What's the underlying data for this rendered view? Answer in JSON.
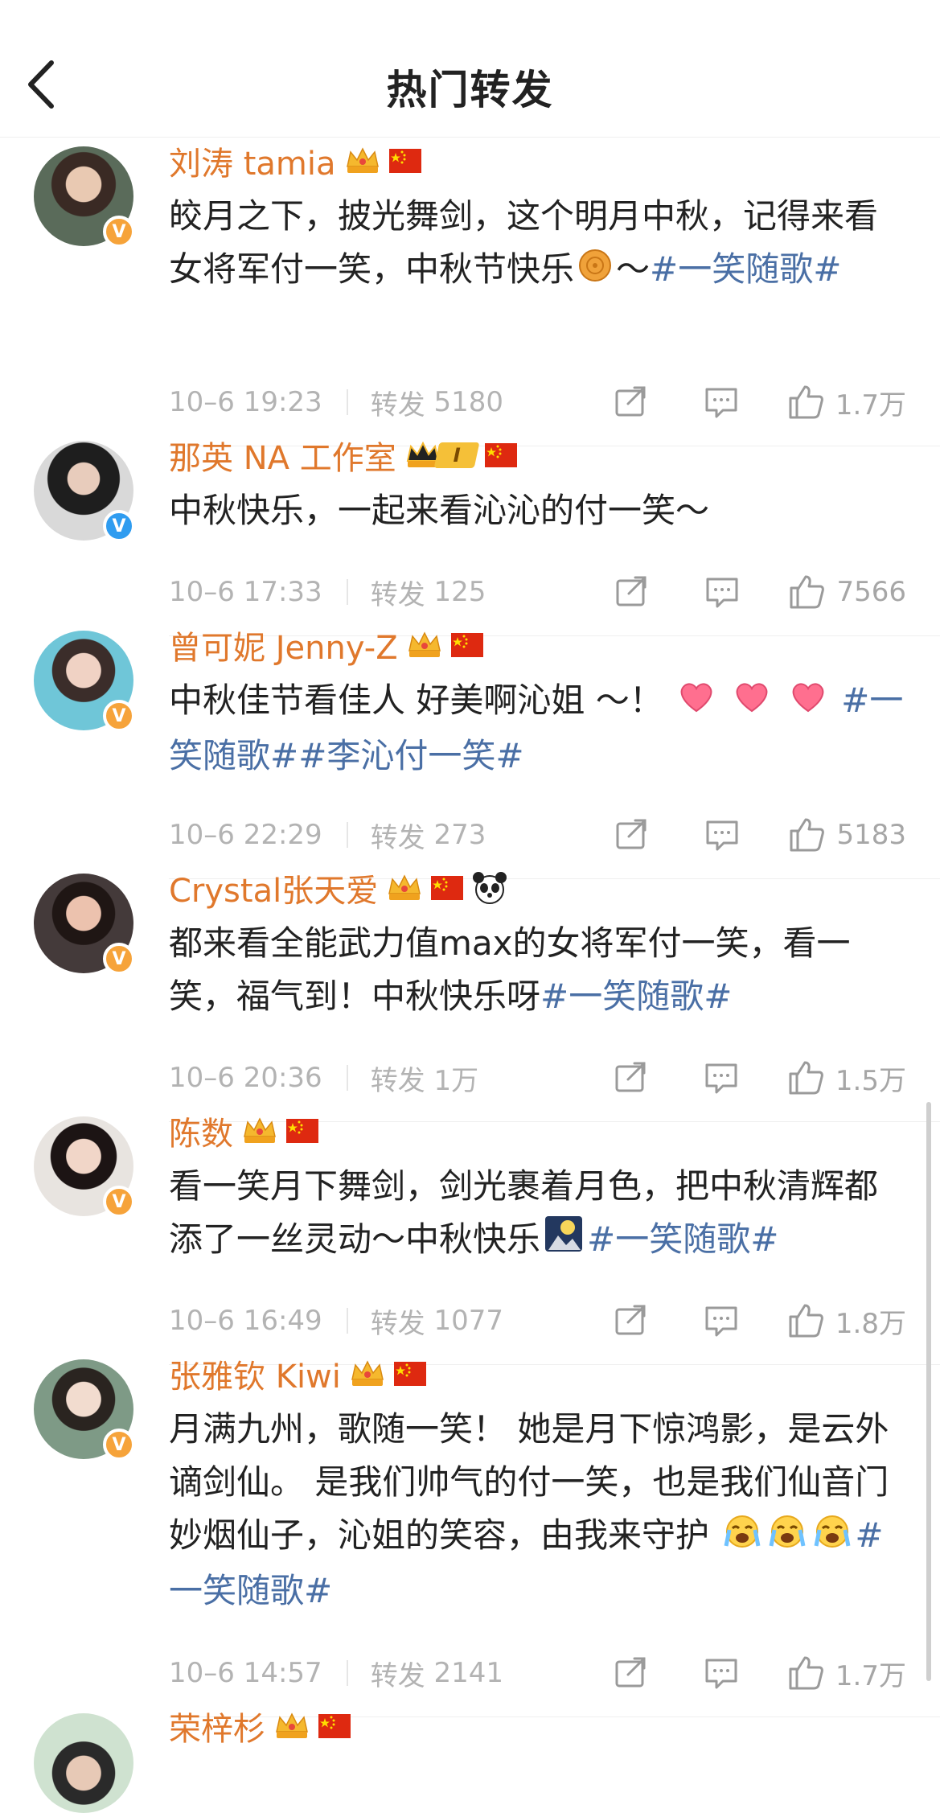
{
  "header": {
    "title": "热门转发"
  },
  "colors": {
    "name": "#e0782c",
    "tag": "#4a6fa5",
    "meta": "#b3b3b3",
    "v_orange": "#f6a33a",
    "v_blue": "#2f9cf0"
  },
  "posts": [
    {
      "name": "刘涛 tamia",
      "badges": [
        "gold-crown-badge",
        "china-flag-icon"
      ],
      "verified": "orange",
      "text_parts": [
        "皎月之下，披光舞剑，这个明月中秋，记得来看女将军付一笑，中秋节快乐",
        "～",
        "#一笑随歌#"
      ],
      "emoji": "mooncake-emoji",
      "time": "10–6 19:23",
      "repost_label": "转发",
      "repost_count": "5180",
      "likes": "1.7万"
    },
    {
      "name": "那英 NA 工作室",
      "badges": [
        "crown-level-badge",
        "china-flag-icon"
      ],
      "level": "I",
      "verified": "blue",
      "text_parts": [
        "中秋快乐，一起来看沁沁的付一笑～"
      ],
      "time": "10–6 17:33",
      "repost_label": "转发",
      "repost_count": "125",
      "likes": "7566"
    },
    {
      "name": "曾可妮 Jenny-Z",
      "badges": [
        "gold-crown-badge",
        "china-flag-icon"
      ],
      "verified": "orange",
      "text_parts": [
        "中秋佳节看佳人 好美啊沁姐 ～！",
        "#一笑随歌##李沁付一笑#"
      ],
      "emoji": "heart-emoji",
      "time": "10–6 22:29",
      "repost_label": "转发",
      "repost_count": "273",
      "likes": "5183"
    },
    {
      "name": "Crystal张天爱",
      "badges": [
        "gold-crown-badge",
        "china-flag-icon",
        "panda-icon"
      ],
      "verified": "orange",
      "text_parts": [
        "都来看全能武力值max的女将军付一笑，看一笑，福气到！中秋快乐呀",
        "#一笑随歌#"
      ],
      "time": "10–6 20:36",
      "repost_label": "转发",
      "repost_count": "1万",
      "likes": "1.5万"
    },
    {
      "name": "陈数",
      "badges": [
        "gold-crown-badge",
        "china-flag-icon"
      ],
      "verified": "orange",
      "text_parts": [
        "看一笑月下舞剑，剑光裹着月色，把中秋清辉都添了一丝灵动～中秋快乐",
        "#一笑随歌#"
      ],
      "emoji": "moon-night-emoji",
      "time": "10–6 16:49",
      "repost_label": "转发",
      "repost_count": "1077",
      "likes": "1.8万"
    },
    {
      "name": "张雅钦 Kiwi",
      "badges": [
        "gold-crown-badge",
        "china-flag-icon"
      ],
      "verified": "orange",
      "text_parts": [
        "月满九州，歌随一笑！ 她是月下惊鸿影，是云外谪剑仙。 是我们帅气的付一笑，也是我们仙音门妙烟仙子，沁姐的笑容，由我来守护",
        "#一笑随歌#"
      ],
      "emoji": "crying-emoji",
      "time": "10–6 14:57",
      "repost_label": "转发",
      "repost_count": "2141",
      "likes": "1.7万"
    },
    {
      "name": "荣梓杉",
      "badges": [
        "gold-crown-badge",
        "china-flag-icon"
      ],
      "verified": "orange"
    }
  ]
}
